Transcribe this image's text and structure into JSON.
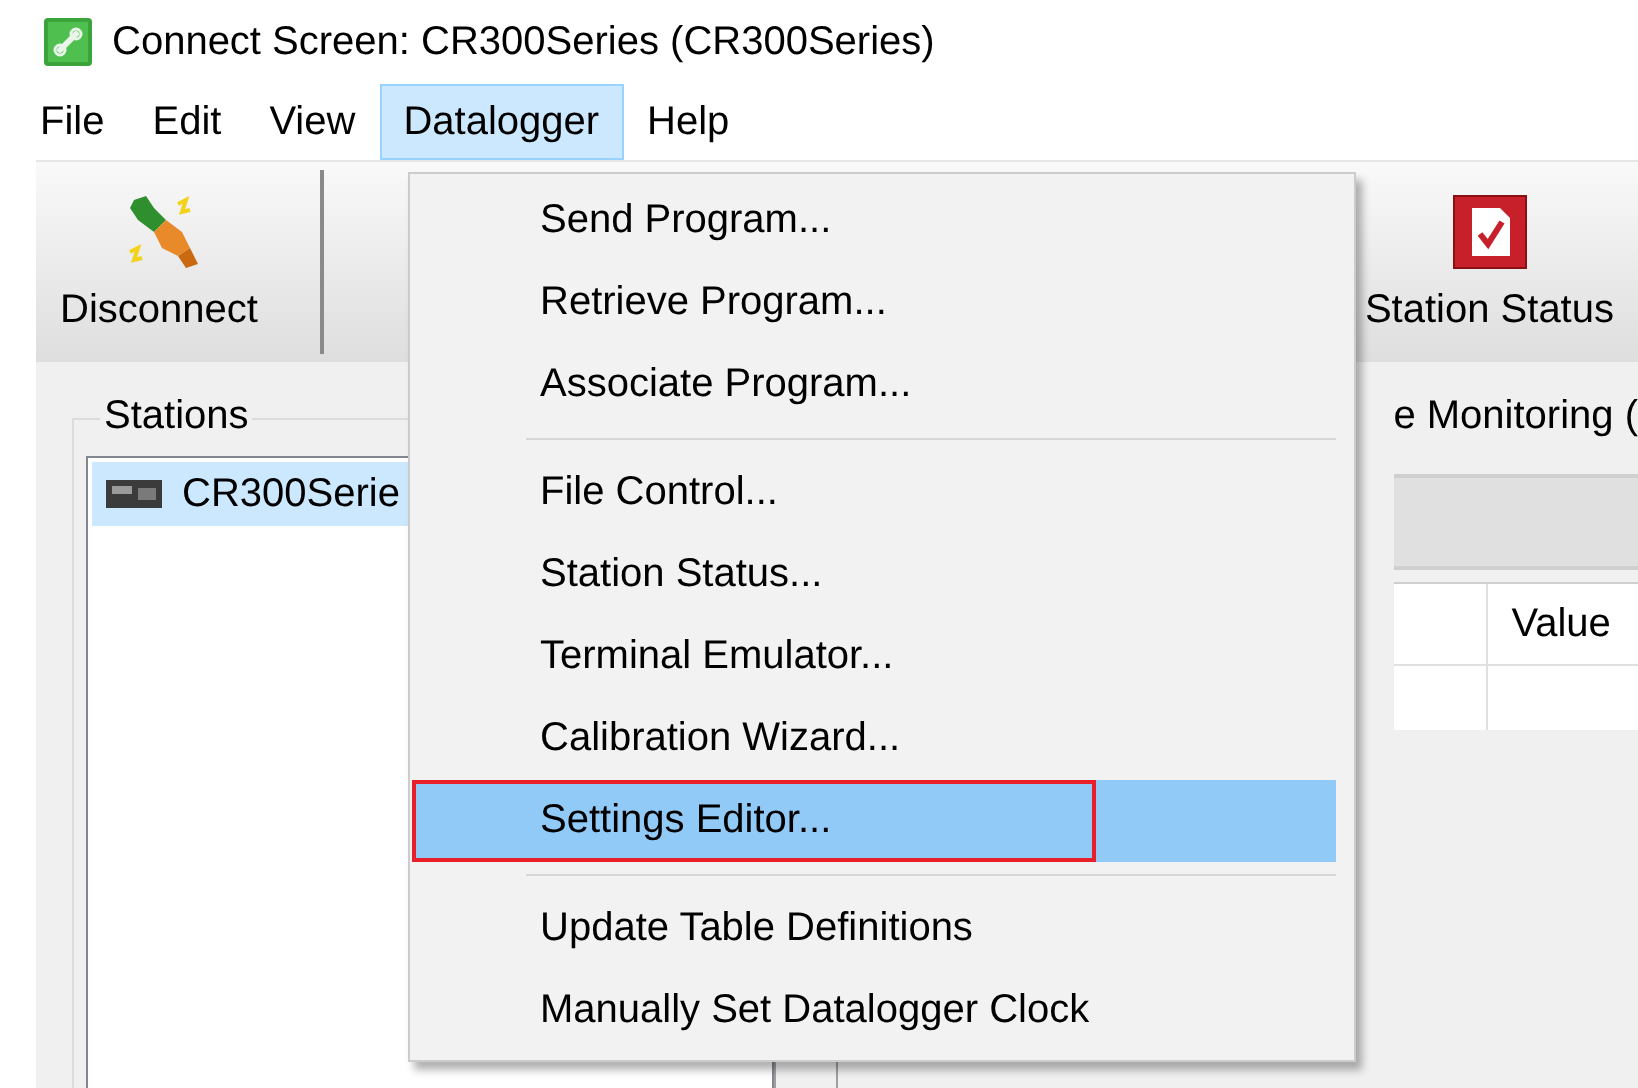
{
  "window": {
    "title": "Connect Screen: CR300Series (CR300Series)"
  },
  "menu_bar": [
    {
      "label": "File",
      "selected": false
    },
    {
      "label": "Edit",
      "selected": false
    },
    {
      "label": "View",
      "selected": false
    },
    {
      "label": "Datalogger",
      "selected": true
    },
    {
      "label": "Help",
      "selected": false
    }
  ],
  "toolbar": [
    {
      "label": "Disconnect",
      "kind": "plug"
    },
    {
      "label": "Station Status",
      "kind": "status"
    }
  ],
  "stations": {
    "title": "Stations",
    "items": [
      {
        "label": "CR300Serie",
        "selected": true
      }
    ]
  },
  "monitoring": {
    "title": "e Monitoring (",
    "columns": [
      {
        "label": "Value"
      }
    ]
  },
  "dropdown": {
    "groups": [
      [
        {
          "label": "Send Program...",
          "highlighted": false,
          "outlined": false
        },
        {
          "label": "Retrieve Program...",
          "highlighted": false,
          "outlined": false
        },
        {
          "label": "Associate Program...",
          "highlighted": false,
          "outlined": false
        }
      ],
      [
        {
          "label": "File Control...",
          "highlighted": false,
          "outlined": false
        },
        {
          "label": "Station Status...",
          "highlighted": false,
          "outlined": false
        },
        {
          "label": "Terminal Emulator...",
          "highlighted": false,
          "outlined": false
        },
        {
          "label": "Calibration Wizard...",
          "highlighted": false,
          "outlined": false
        },
        {
          "label": "Settings Editor...",
          "highlighted": true,
          "outlined": true
        }
      ],
      [
        {
          "label": "Update Table Definitions",
          "highlighted": false,
          "outlined": false
        },
        {
          "label": "Manually Set Datalogger Clock",
          "highlighted": false,
          "outlined": false
        }
      ]
    ]
  }
}
